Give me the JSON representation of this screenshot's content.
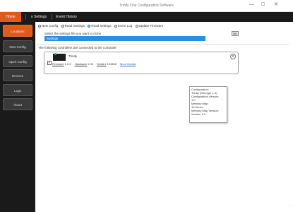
{
  "window": {
    "title": "Trinity One Configuration Software",
    "minimize": "—",
    "maximize": "☐",
    "close": "✕"
  },
  "menu": [
    {
      "label": "Home",
      "active": true
    },
    {
      "label": "≡ Settings",
      "active": false
    },
    {
      "label": "Event History",
      "active": false
    }
  ],
  "sidebar": [
    {
      "label": "Locations",
      "active": true
    },
    {
      "label": "New Config",
      "active": false
    },
    {
      "label": "Open Config",
      "active": false
    },
    {
      "label": "Devices",
      "active": false
    },
    {
      "label": "Logs",
      "active": false
    },
    {
      "label": "About",
      "active": false
    }
  ],
  "action_options": [
    {
      "label": "New Config",
      "checked": false
    },
    {
      "label": "Read Settings",
      "checked": false
    },
    {
      "label": "Read Settings",
      "checked": true
    },
    {
      "label": "Event Log",
      "checked": false
    },
    {
      "label": "Update Firmware",
      "checked": false
    }
  ],
  "settings_prompt": "Select the settings file you want to clone",
  "settings_select_value": "Settings",
  "ok_button": "OK",
  "connected_label": "The following controllers are connected to the computer",
  "device": {
    "checked_glyph": "✓",
    "name": "Trinity",
    "firmware_label": "Firmware",
    "firmware_value": "1.0.0",
    "hardware_label": "Hardware",
    "hardware_value": "1.00",
    "serial_label": "Serial #",
    "serial_value": "123456",
    "details_link": "More Details",
    "close_glyph": "✕"
  },
  "tooltip_lines": [
    "Configuration:",
    "Trinity (Stronger 1.0)",
    "Configuration Version:",
    "1.0",
    "Memory Map:",
    "10 Zones",
    "Memory Map Version:",
    "Version 1.0"
  ],
  "scroll_grip": "⋰"
}
